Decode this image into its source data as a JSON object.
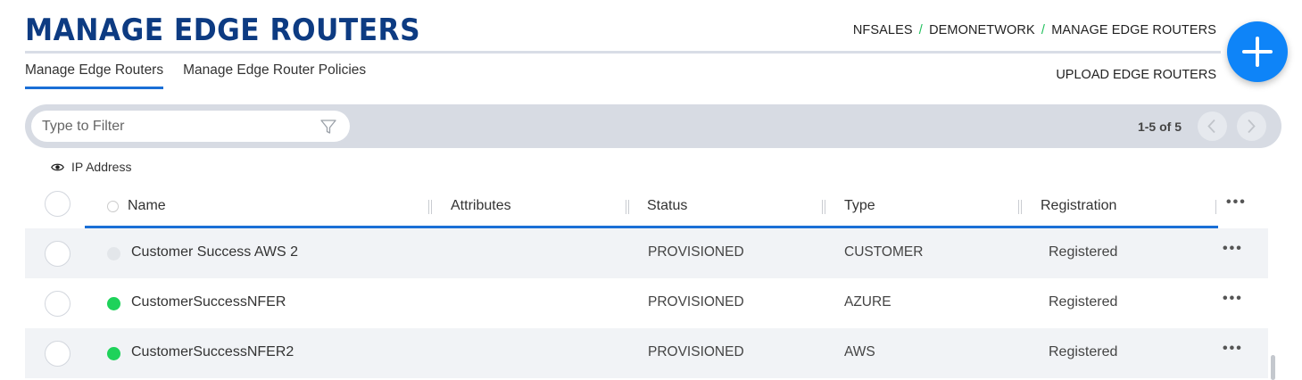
{
  "header": {
    "title": "MANAGE EDGE ROUTERS",
    "breadcrumb": [
      "NFSALES",
      "DEMONETWORK",
      "MANAGE EDGE ROUTERS"
    ],
    "breadcrumb_separator": "/"
  },
  "tabs": [
    {
      "label": "Manage Edge Routers",
      "active": true
    },
    {
      "label": "Manage Edge Router Policies",
      "active": false
    }
  ],
  "upload_label": "UPLOAD EDGE ROUTERS",
  "fab_icon": "plus-icon",
  "filter": {
    "placeholder": "Type to Filter",
    "value": "",
    "icon": "filter-funnel-icon"
  },
  "pager": {
    "count": "1-5 of 5",
    "prev_icon": "chevron-left-icon",
    "next_icon": "chevron-right-icon"
  },
  "ip_toggle": {
    "label": "IP Address",
    "icon": "eye-icon"
  },
  "table": {
    "columns": [
      "Name",
      "Attributes",
      "Status",
      "Type",
      "Registration"
    ],
    "menu_icon": "more-dots-icon",
    "rows": [
      {
        "name": "Customer Success AWS 2",
        "attributes": "",
        "status": "PROVISIONED",
        "type": "CUSTOMER",
        "registration": "Registered",
        "state_color": "#e3e6ea"
      },
      {
        "name": "CustomerSuccessNFER",
        "attributes": "",
        "status": "PROVISIONED",
        "type": "AZURE",
        "registration": "Registered",
        "state_color": "#1ed25a"
      },
      {
        "name": "CustomerSuccessNFER2",
        "attributes": "",
        "status": "PROVISIONED",
        "type": "AWS",
        "registration": "Registered",
        "state_color": "#1ed25a"
      }
    ]
  },
  "colors": {
    "brand": "#0d3b82",
    "accent": "#1a6fd6",
    "fab": "#0e84f8",
    "online": "#1ed25a",
    "breadcrumb_separator": "#20c05c"
  }
}
